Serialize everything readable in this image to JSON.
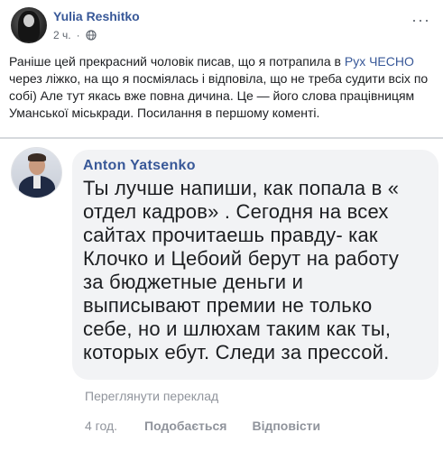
{
  "post": {
    "author": "Yulia Reshitko",
    "time": "2 ч.",
    "privacy_icon": "globe-icon",
    "more_icon": "more-icon",
    "text_lines": [
      {
        "before": "Раніше цей прекрасний чоловік писав, що я потрапила в ",
        "link": "Рух ЧЕСНО",
        "after": ""
      },
      {
        "before": "через ліжко, на що я посміялась і відповіла, що не треба судити всіх по",
        "link": "",
        "after": ""
      },
      {
        "before": "собі) Але тут якась вже повна дичина. Це — його слова працівницям",
        "link": "",
        "after": ""
      },
      {
        "before": "Уманської міськради. Посилання в першому коменті.",
        "link": "",
        "after": ""
      }
    ]
  },
  "comment": {
    "author": "Anton  Yatsenko",
    "lines": [
      "Ты лучше напиши, как попала в «",
      "отдел кадров» . Сегодня на всех",
      "сайтах прочитаешь правду- как",
      "Клочко и Цебоий берут на работу",
      "за бюджетные деньги и",
      "выписывают премии не только",
      "себе, но и шлюхам таким как ты,",
      "которых ебут. Следи за прессой."
    ],
    "translate_label": "Переглянути переклад",
    "time": "4 год.",
    "like_label": "Подобається",
    "reply_label": "Відповісти"
  }
}
